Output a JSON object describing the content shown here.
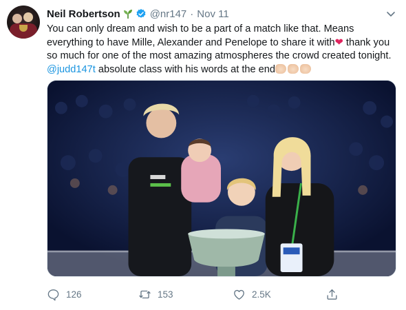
{
  "tweet": {
    "author_name": "Neil Robertson",
    "handle": "@nr147",
    "separator": "·",
    "date": "Nov 11",
    "text_line1": "You can only dream and wish to be a part of a match like that. Means",
    "text_line2": "everything to have Mille, Alexander and Penelope to share it with",
    "heart_emoji": "❤",
    "text_line2_end": " thank",
    "text_line3": "you so much for one of the most amazing atmospheres the crowd created",
    "text_line4_mention": "@judd147t",
    "text_line4": " absolute class with his words at the end",
    "media_icon": "photo-trophy-family"
  },
  "actions": {
    "reply_count": "126",
    "retweet_count": "153",
    "like_count": "2.5K"
  },
  "colors": {
    "accent": "#1da1f2",
    "mention": "#1b95e0",
    "heart": "#e0245e",
    "muted": "#657786"
  }
}
